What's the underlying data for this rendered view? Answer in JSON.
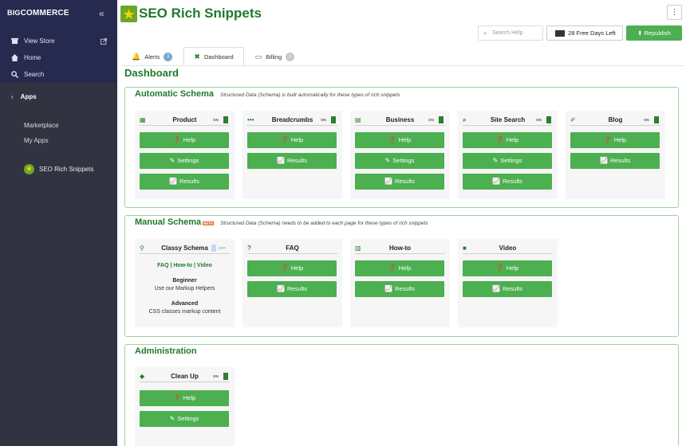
{
  "sidebar": {
    "brand_big": "BIG",
    "brand_rest": "COMMERCE",
    "collapse_glyph": "«",
    "links": [
      {
        "label": "View Store",
        "icon": "store-icon"
      },
      {
        "label": "Home",
        "icon": "home-icon"
      },
      {
        "label": "Search",
        "icon": "search-icon"
      }
    ],
    "apps_label": "Apps",
    "apps_items": [
      "Marketplace",
      "My Apps"
    ],
    "installed_app": "SEO Rich Snippets"
  },
  "header": {
    "title": "SEO Rich Snippets",
    "kebab": "⋮",
    "search_placeholder": "Search Help",
    "trial_label": "28 Free Days Left",
    "republish_label": "Republish"
  },
  "tabs": [
    {
      "label": "Alerts",
      "count": "1"
    },
    {
      "label": "Dashboard"
    },
    {
      "label": "Billing",
      "count": "i"
    }
  ],
  "page_title": "Dashboard",
  "automatic": {
    "title": "Automatic Schema",
    "desc": "Structured Data (Schema) is built automatically for these types of rich snippets",
    "cards": [
      {
        "title": "Product",
        "toggle": "ON",
        "buttons": [
          "Help",
          "Settings",
          "Results"
        ]
      },
      {
        "title": "Breadcrumbs",
        "toggle": "ON",
        "buttons": [
          "Help",
          "Results"
        ]
      },
      {
        "title": "Business",
        "toggle": "ON",
        "buttons": [
          "Help",
          "Settings",
          "Results"
        ]
      },
      {
        "title": "Site Search",
        "toggle": "ON",
        "buttons": [
          "Help",
          "Settings",
          "Results"
        ]
      },
      {
        "title": "Blog",
        "toggle": "ON",
        "buttons": [
          "Help",
          "Results"
        ]
      }
    ]
  },
  "manual": {
    "title": "Manual Schema",
    "beta": "BETA",
    "desc": "Structured Data (Schema) needs to be added to each page for these types of rich snippets",
    "classy": {
      "title": "Classy Schema",
      "toggle": "OFF",
      "links": "FAQ | How-to | Video",
      "beginner": "Beginner",
      "beginner_desc": "Use our Markup Helpers",
      "advanced": "Advanced",
      "advanced_desc": "CSS classes markup content"
    },
    "cards": [
      {
        "title": "FAQ",
        "buttons": [
          "Help",
          "Results"
        ]
      },
      {
        "title": "How-to",
        "buttons": [
          "Help",
          "Results"
        ]
      },
      {
        "title": "Video",
        "buttons": [
          "Help",
          "Results"
        ]
      }
    ]
  },
  "admin": {
    "title": "Administration",
    "card": {
      "title": "Clean Up",
      "toggle": "ON",
      "buttons": [
        "Help",
        "Settings"
      ]
    }
  },
  "colors": {
    "accent": "#1f7a2b",
    "button": "#4caf50",
    "sidebar": "#313440"
  }
}
